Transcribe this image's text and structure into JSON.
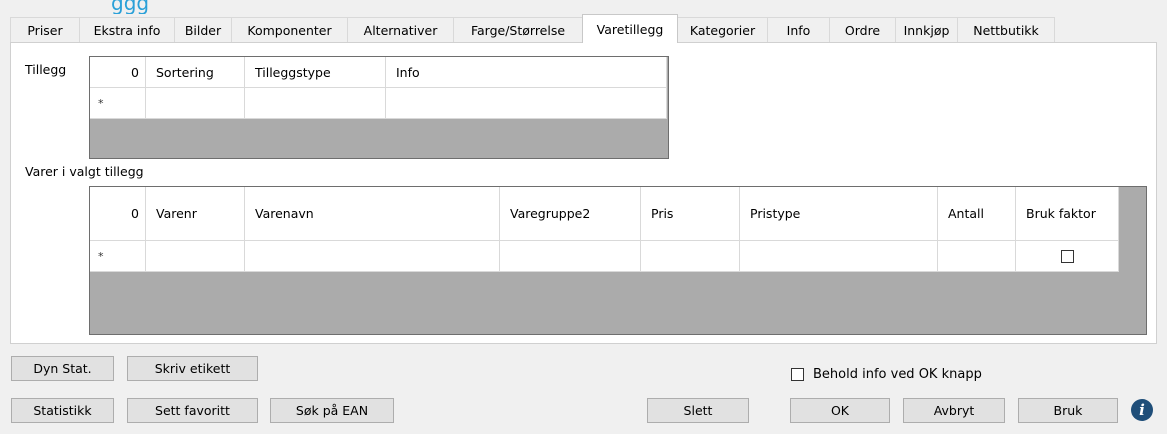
{
  "header": {
    "title_fragment": "ggg"
  },
  "tabs": [
    {
      "label": "Priser",
      "active": false
    },
    {
      "label": "Ekstra info",
      "active": false
    },
    {
      "label": "Bilder",
      "active": false
    },
    {
      "label": "Komponenter",
      "active": false
    },
    {
      "label": "Alternativer",
      "active": false
    },
    {
      "label": "Farge/Størrelse",
      "active": false
    },
    {
      "label": "Varetillegg",
      "active": true
    },
    {
      "label": "Kategorier",
      "active": false
    },
    {
      "label": "Info",
      "active": false
    },
    {
      "label": "Ordre",
      "active": false
    },
    {
      "label": "Innkjøp",
      "active": false
    },
    {
      "label": "Nettbutikk",
      "active": false
    }
  ],
  "tillegg": {
    "label": "Tillegg",
    "row_count": "0",
    "columns": [
      "Sortering",
      "Tilleggstype",
      "Info"
    ],
    "new_row_marker": "*"
  },
  "varer": {
    "label": "Varer i valgt tillegg",
    "row_count": "0",
    "columns": [
      "Varenr",
      "Varenavn",
      "Varegruppe2",
      "Pris",
      "Pristype",
      "Antall",
      "Bruk faktor"
    ],
    "new_row_marker": "*"
  },
  "buttons": {
    "dyn_stat": "Dyn Stat.",
    "skriv_etikett": "Skriv etikett",
    "statistikk": "Statistikk",
    "sett_favoritt": "Sett favoritt",
    "sok_ean": "Søk på EAN",
    "slett": "Slett",
    "ok": "OK",
    "avbryt": "Avbryt",
    "bruk": "Bruk"
  },
  "behold_checkbox": {
    "label": "Behold info ved OK knapp",
    "checked": false
  },
  "info_icon": {
    "symbol": "i",
    "icon": "info-icon"
  },
  "colors": {
    "accent": "#2aa0d8",
    "grid_background": "#ababab",
    "info_icon": "#1f4e79"
  }
}
